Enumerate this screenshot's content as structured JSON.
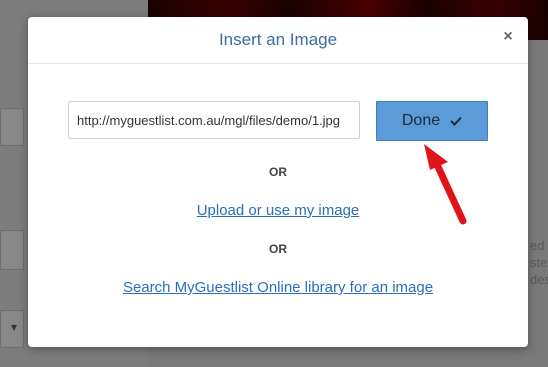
{
  "modal": {
    "title": "Insert an Image",
    "close_glyph": "×",
    "url_input": {
      "value": "http://myguestlist.com.au/mgl/files/demo/1.jpg",
      "placeholder": ""
    },
    "done_button": {
      "label": "Done",
      "icon": "check-icon"
    },
    "or_label_1": "OR",
    "upload_link": "Upload or use my image",
    "or_label_2": "OR",
    "library_link": "Search MyGuestlist Online library for an image"
  },
  "background_fragments": {
    "dropdown_glyph": "▾",
    "right_text_1": "ed",
    "right_text_2": "ste",
    "right_text_3": "des"
  },
  "annotation": {
    "arrow_color": "#e0131b",
    "points_to": "done-button"
  },
  "colors": {
    "title": "#3b6e9f",
    "done_button_bg": "#5b9bd8",
    "link": "#2a6ebd"
  }
}
